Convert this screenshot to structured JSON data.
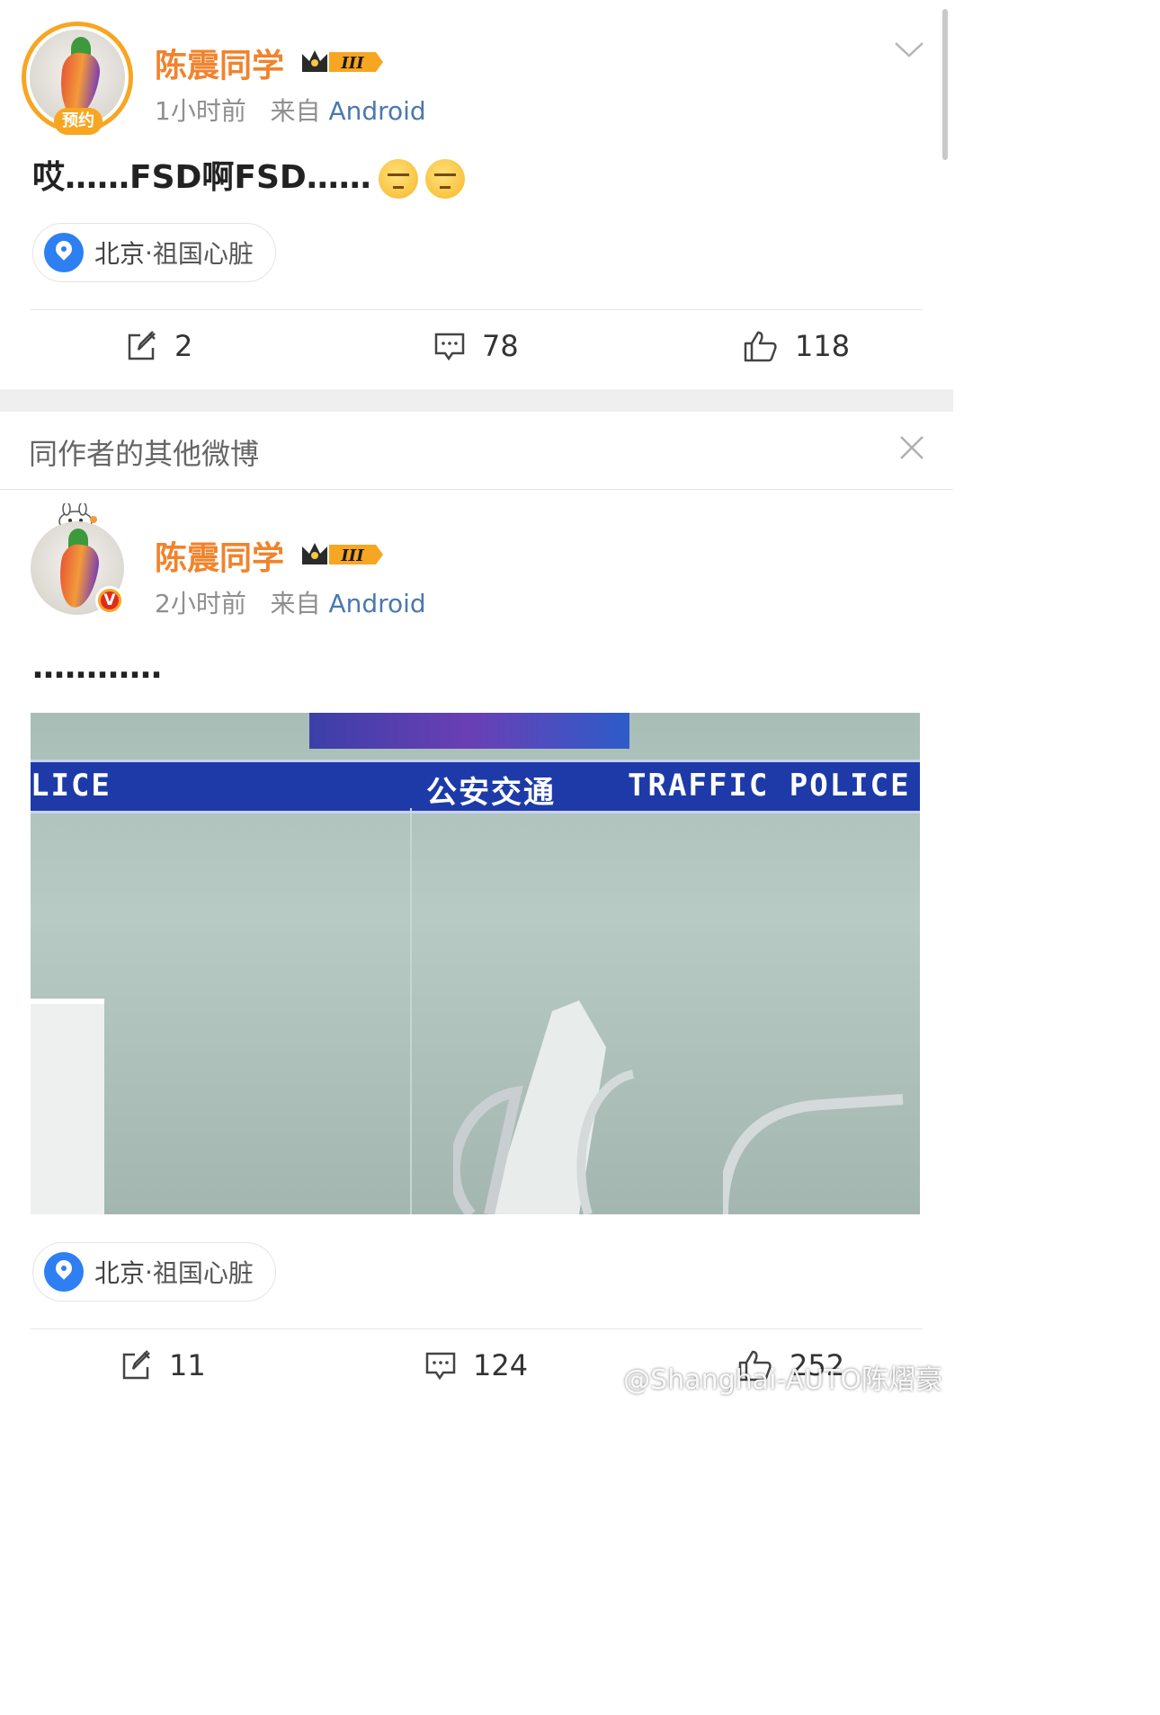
{
  "post1": {
    "author": "陈震同学",
    "reserve_badge": "预约",
    "time": "1小时前",
    "from_label": "来自",
    "source": "Android",
    "text": "哎……FSD啊FSD……",
    "location": {
      "city": "北京",
      "separator": "·",
      "place": "祖国心脏"
    },
    "reposts": "2",
    "comments": "78",
    "likes": "118"
  },
  "recommend": {
    "title": "同作者的其他微博"
  },
  "post2": {
    "author": "陈震同学",
    "verified_mark": "V",
    "time": "2小时前",
    "from_label": "来自",
    "source": "Android",
    "text": "…………",
    "photo_signs": {
      "left": "LICE",
      "center": "公安交通",
      "right": "TRAFFIC POLICE"
    },
    "location": {
      "city": "北京",
      "separator": "·",
      "place": "祖国心脏"
    },
    "reposts": "11",
    "comments": "124",
    "likes": "252"
  },
  "crown_level": "III",
  "watermark": "@Shanghai-AUTO陈熠豪",
  "colors": {
    "name": "#f0832c",
    "source": "#4a78b0",
    "crown": "#f7a623",
    "location_icon": "#2d7ff2"
  },
  "icons": [
    "chevron-down-icon",
    "close-icon",
    "repost-icon",
    "comment-icon",
    "like-icon",
    "location-icon",
    "crown-icon"
  ]
}
